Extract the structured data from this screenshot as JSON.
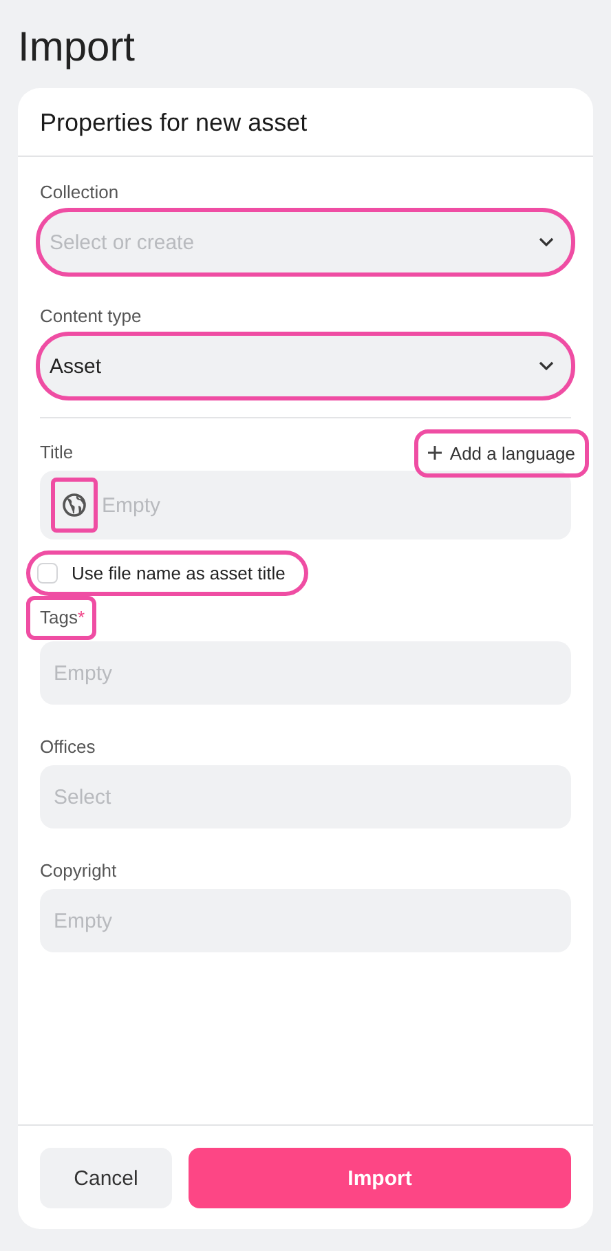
{
  "title": "Import",
  "card": {
    "heading": "Properties for new asset",
    "top_fields": [
      {
        "kind": "select",
        "label": "Collection",
        "placeholder": "Select or create",
        "highlighted": true
      },
      {
        "kind": "select",
        "label": "Content type",
        "value": "Asset",
        "highlighted": true
      }
    ],
    "fields": [
      {
        "kind": "localized",
        "label": "Title",
        "placeholder": "Empty",
        "icon_highlighted": true,
        "action": {
          "label": "Add a language",
          "highlighted": true
        }
      },
      {
        "kind": "checkbox",
        "label": "Use file name as asset title",
        "checked": false,
        "highlighted": true
      },
      {
        "kind": "text",
        "label": "Tags",
        "required_mark": "*",
        "label_highlighted": true,
        "placeholder": "Empty"
      },
      {
        "kind": "text",
        "label": "Offices",
        "placeholder": "Select"
      },
      {
        "kind": "text",
        "label": "Copyright",
        "placeholder": "Empty"
      }
    ],
    "buttons": [
      {
        "kind": "secondary",
        "label": "Cancel"
      },
      {
        "kind": "primary",
        "label": "Import"
      }
    ]
  }
}
